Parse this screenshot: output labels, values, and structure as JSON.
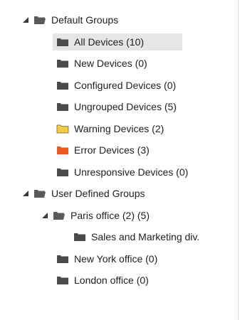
{
  "tree": {
    "default_groups": {
      "label": "Default Groups",
      "children": [
        {
          "label": "All Devices (10)",
          "color": "#4b4b4b",
          "selected": true
        },
        {
          "label": "New Devices (0)",
          "color": "#4b4b4b"
        },
        {
          "label": "Configured Devices (0)",
          "color": "#4b4b4b"
        },
        {
          "label": "Ungrouped Devices (5)",
          "color": "#4b4b4b"
        },
        {
          "label": "Warning Devices (2)",
          "color": "#f3c94b"
        },
        {
          "label": "Error Devices (3)",
          "color": "#e8591c"
        },
        {
          "label": "Unresponsive Devices (0)",
          "color": "#4b4b4b"
        }
      ]
    },
    "user_defined_groups": {
      "label": "User Defined Groups",
      "paris": {
        "label": "Paris office (2) (5)",
        "children": [
          {
            "label": "Sales and Marketing div."
          }
        ]
      },
      "others": [
        {
          "label": "New York office (0)"
        },
        {
          "label": "London office (0)"
        }
      ]
    },
    "icons": {
      "expanded_toggle": "expand-triangle-icon",
      "open_folder": "folder-open-icon",
      "closed_folder": "folder-icon"
    }
  }
}
